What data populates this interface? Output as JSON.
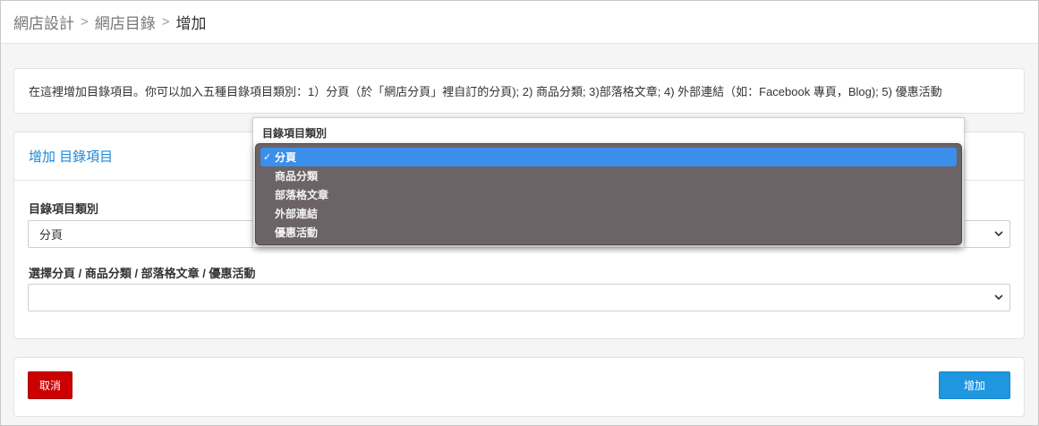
{
  "breadcrumb": {
    "items": [
      "網店設計",
      "網店目錄",
      "增加"
    ],
    "separator": ">"
  },
  "info": {
    "text": "在這裡增加目錄項目。你可以加入五種目錄項目類別：1）分頁（於「網店分頁」裡自訂的分頁); 2) 商品分類; 3)部落格文章; 4) 外部連結（如：Facebook 專頁，Blog); 5) 優惠活動"
  },
  "form": {
    "heading": "增加 目錄項目",
    "category_label": "目錄項目類別",
    "category_value": "分頁",
    "target_label": "選擇分頁 / 商品分類 / 部落格文章 / 優惠活動",
    "target_value": ""
  },
  "dropdown": {
    "title": "目錄項目類別",
    "options": [
      "分頁",
      "商品分類",
      "部落格文章",
      "外部連結",
      "優惠活動"
    ],
    "selected_index": 0,
    "check_mark": "✓"
  },
  "actions": {
    "cancel_label": "取消",
    "add_label": "增加"
  },
  "colors": {
    "accent": "#1e88d8",
    "cancel": "#cc0000",
    "add": "#1f96e0",
    "menu_bg": "#6b6366",
    "menu_selected": "#3b8eea"
  },
  "icons": {
    "breadcrumb_separator": "chevron-right-icon",
    "select_arrow": "chevron-down-icon",
    "selected_mark": "checkmark-icon"
  }
}
